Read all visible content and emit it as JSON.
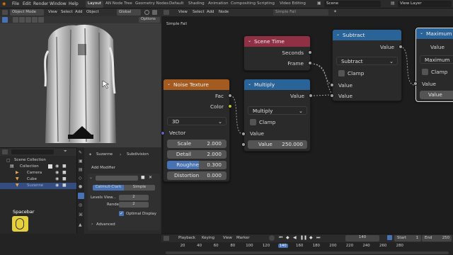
{
  "menu": [
    "File",
    "Edit",
    "Render",
    "Window",
    "Help"
  ],
  "workspaces": [
    "Layout",
    "AN Node Tree",
    "Geometry Nodes",
    "Default",
    "Shading",
    "Animation",
    "Compositing",
    "Scripting",
    "Video Editing"
  ],
  "active_workspace": "Layout",
  "scene": "Scene",
  "view_layer": "View Layer",
  "viewport": {
    "mode": "Object Mode",
    "menus": [
      "View",
      "Select",
      "Add",
      "Object"
    ],
    "transform": "Global",
    "options": "Options"
  },
  "node_editor": {
    "menus": [
      "View",
      "Select",
      "Add",
      "Node"
    ],
    "tree_name": "Simple Fall",
    "breadcrumb": "Simple Fall"
  },
  "nodes": {
    "scene_time": {
      "title": "Scene Time",
      "outputs": [
        "Seconds",
        "Frame"
      ]
    },
    "noise": {
      "title": "Noise Texture",
      "outputs": [
        "Fac",
        "Color"
      ],
      "dimension": "3D",
      "vector_label": "Vector",
      "fields": [
        {
          "label": "Scale",
          "value": "2.000"
        },
        {
          "label": "Detail",
          "value": "2.000"
        },
        {
          "label": "Roughne",
          "value": "0.300"
        },
        {
          "label": "Distortion",
          "value": "0.000"
        }
      ]
    },
    "multiply": {
      "title": "Multiply",
      "output": "Value",
      "operation": "Multiply",
      "clamp": "Clamp",
      "input": "Value",
      "field_label": "Value",
      "field_value": "250.000"
    },
    "subtract": {
      "title": "Subtract",
      "output": "Value",
      "operation": "Subtract",
      "clamp": "Clamp",
      "inputs": [
        "Value",
        "Value"
      ]
    },
    "maximum": {
      "title": "Maximum",
      "output": "Value",
      "operation": "Maximum",
      "clamp": "Clamp",
      "input": "Value",
      "field_label": "Value"
    }
  },
  "outliner": {
    "root": "Scene Collection",
    "items": [
      "Collection",
      "Camera",
      "Cube",
      "Suzanne"
    ]
  },
  "properties": {
    "object": "Suzanne",
    "modifier": "Subdivision",
    "add_modifier": "Add Modifier",
    "tabs": [
      "Catmull-Clark",
      "Simple"
    ],
    "levels_viewport_label": "Levels View...",
    "levels_viewport": "2",
    "render_label": "Render",
    "render": "2",
    "optimal_display": "Optimal Display",
    "advanced": "Advanced"
  },
  "timeline": {
    "menus": [
      "Playback",
      "Keying",
      "View",
      "Marker"
    ],
    "current_frame": "140",
    "start_label": "Start",
    "start": "1",
    "end_label": "End",
    "end": "250",
    "ticks": [
      "20",
      "40",
      "60",
      "80",
      "100",
      "120",
      "140",
      "160",
      "180",
      "200",
      "220",
      "240",
      "260",
      "280"
    ]
  },
  "key_overlay": "Spacebar",
  "colors": {
    "node_blue": "#2a6398",
    "node_orange": "#a45b1f",
    "node_red": "#8f3045",
    "accent": "#4772b3"
  }
}
